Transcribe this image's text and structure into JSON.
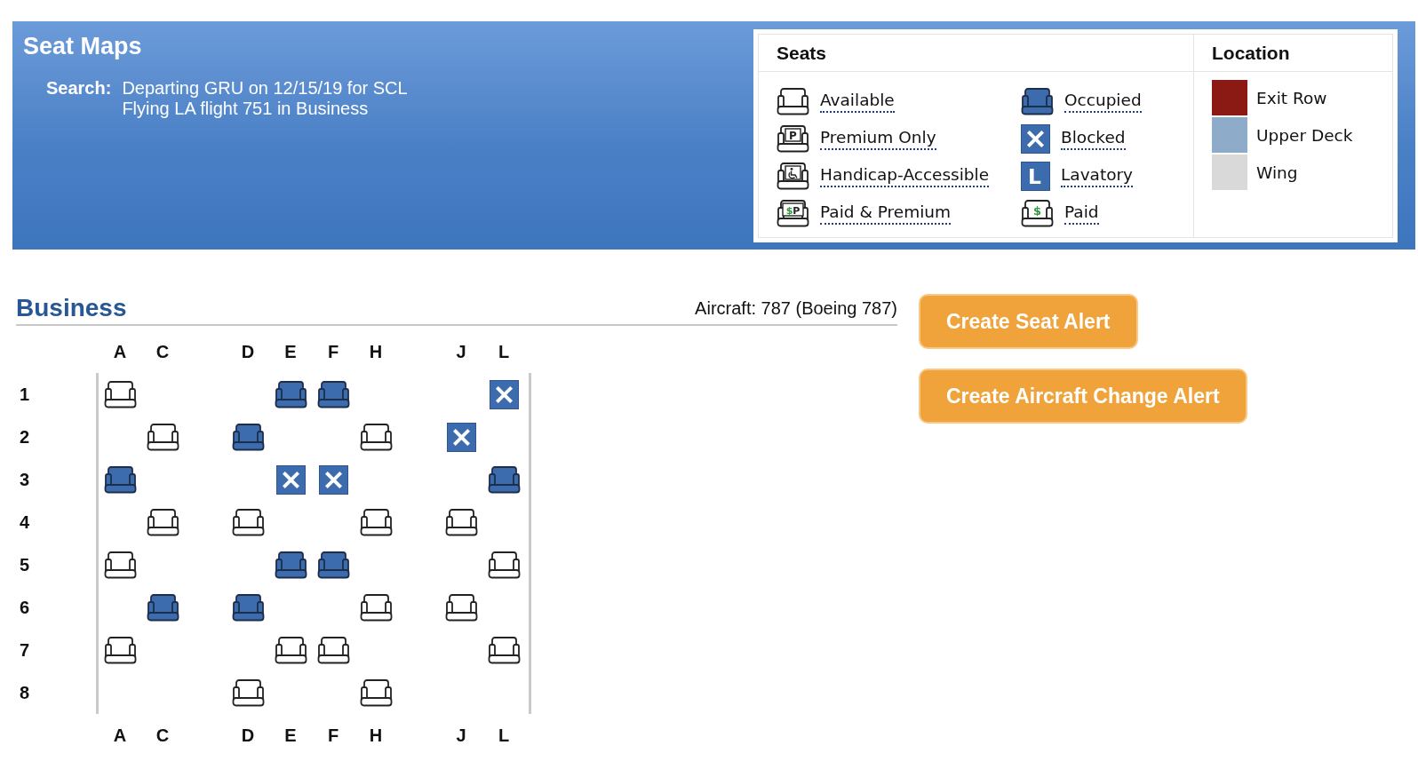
{
  "header": {
    "title": "Seat Maps",
    "search": {
      "label": "Search:",
      "lines": [
        "Departing GRU on 12/15/19 for SCL",
        "Flying LA flight 751 in Business"
      ]
    },
    "legend": {
      "seats": {
        "heading": "Seats",
        "items": [
          {
            "kind": "available",
            "label": "Available"
          },
          {
            "kind": "premium",
            "label": "Premium Only",
            "glyphs": [
              "P"
            ]
          },
          {
            "kind": "handicap",
            "label": "Handicap-Accessible"
          },
          {
            "kind": "paid_premium",
            "label": "Paid & Premium",
            "glyphs": [
              "$",
              "P"
            ]
          },
          {
            "kind": "occupied",
            "label": "Occupied"
          },
          {
            "kind": "blocked",
            "label": "Blocked"
          },
          {
            "kind": "lavatory",
            "label": "Lavatory",
            "glyphs": [
              "L"
            ]
          },
          {
            "kind": "paid",
            "label": "Paid",
            "glyphs": [
              "$"
            ]
          }
        ]
      },
      "location": {
        "heading": "Location",
        "items": [
          {
            "label": "Exit Row",
            "color": "#8b1a14"
          },
          {
            "label": "Upper Deck",
            "color": "#8eabc9"
          },
          {
            "label": "Wing",
            "color": "#d9d9d9"
          }
        ]
      }
    }
  },
  "section": {
    "title": "Business",
    "aircraft": "Aircraft: 787 (Boeing 787)"
  },
  "seat_map": {
    "column_groups_top": [
      [
        "A",
        "C"
      ],
      [
        "D",
        "E",
        "F",
        "H"
      ],
      [
        "J",
        "L"
      ]
    ],
    "rows": [
      {
        "number": "1",
        "seat_groups": [
          [
            {
              "kind": "available"
            },
            {
              "kind": "none"
            }
          ],
          [
            {
              "kind": "none"
            },
            {
              "kind": "occupied"
            },
            {
              "kind": "occupied"
            },
            {
              "kind": "none"
            }
          ],
          [
            {
              "kind": "none"
            },
            {
              "kind": "blocked"
            }
          ]
        ]
      },
      {
        "number": "2",
        "seat_groups": [
          [
            {
              "kind": "none"
            },
            {
              "kind": "available"
            }
          ],
          [
            {
              "kind": "occupied"
            },
            {
              "kind": "none"
            },
            {
              "kind": "none"
            },
            {
              "kind": "available"
            }
          ],
          [
            {
              "kind": "blocked"
            },
            {
              "kind": "none"
            }
          ]
        ]
      },
      {
        "number": "3",
        "seat_groups": [
          [
            {
              "kind": "occupied"
            },
            {
              "kind": "none"
            }
          ],
          [
            {
              "kind": "none"
            },
            {
              "kind": "blocked"
            },
            {
              "kind": "blocked"
            },
            {
              "kind": "none"
            }
          ],
          [
            {
              "kind": "none"
            },
            {
              "kind": "occupied"
            }
          ]
        ]
      },
      {
        "number": "4",
        "seat_groups": [
          [
            {
              "kind": "none"
            },
            {
              "kind": "available"
            }
          ],
          [
            {
              "kind": "available"
            },
            {
              "kind": "none"
            },
            {
              "kind": "none"
            },
            {
              "kind": "available"
            }
          ],
          [
            {
              "kind": "available"
            },
            {
              "kind": "none"
            }
          ]
        ]
      },
      {
        "number": "5",
        "seat_groups": [
          [
            {
              "kind": "available"
            },
            {
              "kind": "none"
            }
          ],
          [
            {
              "kind": "none"
            },
            {
              "kind": "occupied"
            },
            {
              "kind": "occupied"
            },
            {
              "kind": "none"
            }
          ],
          [
            {
              "kind": "none"
            },
            {
              "kind": "available"
            }
          ]
        ]
      },
      {
        "number": "6",
        "seat_groups": [
          [
            {
              "kind": "none"
            },
            {
              "kind": "occupied"
            }
          ],
          [
            {
              "kind": "occupied"
            },
            {
              "kind": "none"
            },
            {
              "kind": "none"
            },
            {
              "kind": "available"
            }
          ],
          [
            {
              "kind": "available"
            },
            {
              "kind": "none"
            }
          ]
        ]
      },
      {
        "number": "7",
        "seat_groups": [
          [
            {
              "kind": "available"
            },
            {
              "kind": "none"
            }
          ],
          [
            {
              "kind": "none"
            },
            {
              "kind": "available"
            },
            {
              "kind": "available"
            },
            {
              "kind": "none"
            }
          ],
          [
            {
              "kind": "none"
            },
            {
              "kind": "available"
            }
          ]
        ]
      },
      {
        "number": "8",
        "seat_groups": [
          [
            {
              "kind": "none"
            },
            {
              "kind": "none"
            }
          ],
          [
            {
              "kind": "available"
            },
            {
              "kind": "none"
            },
            {
              "kind": "none"
            },
            {
              "kind": "available"
            }
          ],
          [
            {
              "kind": "none"
            },
            {
              "kind": "none"
            }
          ]
        ]
      }
    ],
    "column_groups_bottom": [
      [
        "A",
        "C"
      ],
      [
        "D",
        "E",
        "F",
        "H"
      ],
      [
        "J",
        "L"
      ]
    ]
  },
  "buttons": [
    "Create Seat Alert",
    "Create Aircraft Change Alert"
  ]
}
